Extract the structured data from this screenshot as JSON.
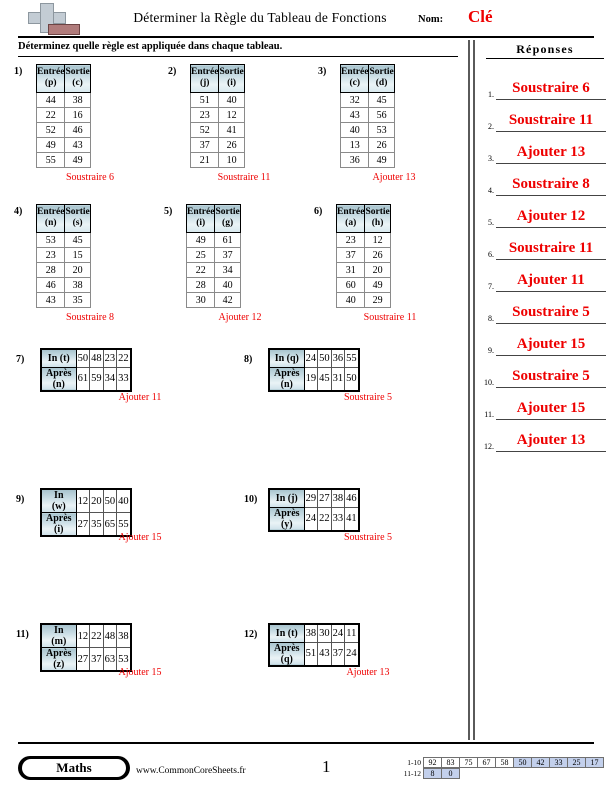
{
  "header": {
    "title": "Déterminer la Règle du Tableau de Fonctions",
    "name_label": "Nom:",
    "name_value": "Clé",
    "logo_icon": "plus-book-logo"
  },
  "instruction": "Déterminez quelle règle est appliquée dans chaque tableau.",
  "answers": {
    "title": "Réponses",
    "items": [
      {
        "num": "1.",
        "value": "Soustraire 6"
      },
      {
        "num": "2.",
        "value": "Soustraire 11"
      },
      {
        "num": "3.",
        "value": "Ajouter 13"
      },
      {
        "num": "4.",
        "value": "Soustraire 8"
      },
      {
        "num": "5.",
        "value": "Ajouter 12"
      },
      {
        "num": "6.",
        "value": "Soustraire 11"
      },
      {
        "num": "7.",
        "value": "Ajouter 11"
      },
      {
        "num": "8.",
        "value": "Soustraire 5"
      },
      {
        "num": "9.",
        "value": "Ajouter 15"
      },
      {
        "num": "10.",
        "value": "Soustraire 5"
      },
      {
        "num": "11.",
        "value": "Ajouter 15"
      },
      {
        "num": "12.",
        "value": "Ajouter 13"
      }
    ]
  },
  "vertical_problems": [
    {
      "num": "1)",
      "head_in": "Entrée",
      "var_in": "(p)",
      "head_out": "Sortie",
      "var_out": "(c)",
      "rows": [
        [
          "44",
          "38"
        ],
        [
          "22",
          "16"
        ],
        [
          "52",
          "46"
        ],
        [
          "49",
          "43"
        ],
        [
          "55",
          "49"
        ]
      ],
      "rule": "Soustraire 6"
    },
    {
      "num": "2)",
      "head_in": "Entrée",
      "var_in": "(j)",
      "head_out": "Sortie",
      "var_out": "(i)",
      "rows": [
        [
          "51",
          "40"
        ],
        [
          "23",
          "12"
        ],
        [
          "52",
          "41"
        ],
        [
          "37",
          "26"
        ],
        [
          "21",
          "10"
        ]
      ],
      "rule": "Soustraire 11"
    },
    {
      "num": "3)",
      "head_in": "Entrée",
      "var_in": "(c)",
      "head_out": "Sortie",
      "var_out": "(d)",
      "rows": [
        [
          "32",
          "45"
        ],
        [
          "43",
          "56"
        ],
        [
          "40",
          "53"
        ],
        [
          "13",
          "26"
        ],
        [
          "36",
          "49"
        ]
      ],
      "rule": "Ajouter 13"
    },
    {
      "num": "4)",
      "head_in": "Entrée",
      "var_in": "(n)",
      "head_out": "Sortie",
      "var_out": "(s)",
      "rows": [
        [
          "53",
          "45"
        ],
        [
          "23",
          "15"
        ],
        [
          "28",
          "20"
        ],
        [
          "46",
          "38"
        ],
        [
          "43",
          "35"
        ]
      ],
      "rule": "Soustraire 8"
    },
    {
      "num": "5)",
      "head_in": "Entrée",
      "var_in": "(i)",
      "head_out": "Sortie",
      "var_out": "(g)",
      "rows": [
        [
          "49",
          "61"
        ],
        [
          "25",
          "37"
        ],
        [
          "22",
          "34"
        ],
        [
          "28",
          "40"
        ],
        [
          "30",
          "42"
        ]
      ],
      "rule": "Ajouter 12"
    },
    {
      "num": "6)",
      "head_in": "Entrée",
      "var_in": "(a)",
      "head_out": "Sortie",
      "var_out": "(h)",
      "rows": [
        [
          "23",
          "12"
        ],
        [
          "37",
          "26"
        ],
        [
          "31",
          "20"
        ],
        [
          "60",
          "49"
        ],
        [
          "40",
          "29"
        ]
      ],
      "rule": "Soustraire 11"
    }
  ],
  "horizontal_problems": [
    {
      "num": "7)",
      "label_in": "In (t)",
      "label_out": "Après (n)",
      "values_in": [
        "50",
        "48",
        "23",
        "22"
      ],
      "values_out": [
        "61",
        "59",
        "34",
        "33"
      ],
      "rule": "Ajouter 11"
    },
    {
      "num": "8)",
      "label_in": "In (q)",
      "label_out": "Après (n)",
      "values_in": [
        "24",
        "50",
        "36",
        "55"
      ],
      "values_out": [
        "19",
        "45",
        "31",
        "50"
      ],
      "rule": "Soustraire 5"
    },
    {
      "num": "9)",
      "label_in": "In (w)",
      "label_out": "Après (i)",
      "values_in": [
        "12",
        "20",
        "50",
        "40"
      ],
      "values_out": [
        "27",
        "35",
        "65",
        "55"
      ],
      "rule": "Ajouter 15"
    },
    {
      "num": "10)",
      "label_in": "In (j)",
      "label_out": "Après (y)",
      "values_in": [
        "29",
        "27",
        "38",
        "46"
      ],
      "values_out": [
        "24",
        "22",
        "33",
        "41"
      ],
      "rule": "Soustraire 5"
    },
    {
      "num": "11)",
      "label_in": "In (m)",
      "label_out": "Après (z)",
      "values_in": [
        "12",
        "22",
        "48",
        "38"
      ],
      "values_out": [
        "27",
        "37",
        "63",
        "53"
      ],
      "rule": "Ajouter 15"
    },
    {
      "num": "12)",
      "label_in": "In (t)",
      "label_out": "Après (q)",
      "values_in": [
        "38",
        "30",
        "24",
        "11"
      ],
      "values_out": [
        "51",
        "43",
        "37",
        "24"
      ],
      "rule": "Ajouter 13"
    }
  ],
  "footer": {
    "subject": "Maths",
    "website": "www.CommonCoreSheets.fr",
    "page_number": "1",
    "scale": {
      "row1_label": "1-10",
      "row1_values": [
        "92",
        "83",
        "75",
        "67",
        "58",
        "50",
        "42",
        "33",
        "25",
        "17"
      ],
      "row1_highlight": [
        false,
        false,
        false,
        false,
        false,
        true,
        true,
        true,
        true,
        true
      ],
      "row2_label": "11-12",
      "row2_values": [
        "8",
        "0"
      ],
      "row2_highlight": [
        true,
        true
      ]
    }
  }
}
